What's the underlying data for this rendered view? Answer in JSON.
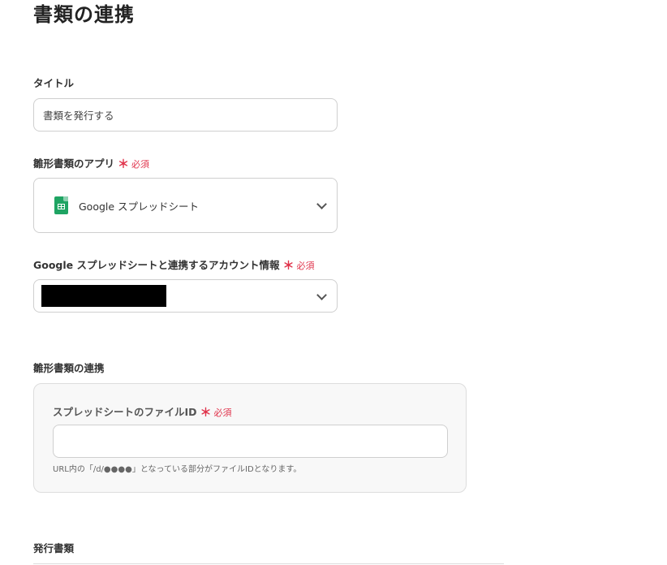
{
  "page_title": "書類の連携",
  "title_field": {
    "label": "タイトル",
    "value": "書類を発行する"
  },
  "template_app": {
    "label": "雛形書類のアプリ",
    "required_mark": "＊",
    "required_text": "必須",
    "selected_value": "Google スプレッドシート",
    "icon": "google-sheets-icon"
  },
  "account": {
    "label": "Google スプレッドシートと連携するアカウント情報",
    "required_mark": "＊",
    "required_text": "必須"
  },
  "template_link": {
    "section_label": "雛形書類の連携",
    "file_id_label": "スプレッドシートのファイルID",
    "required_mark": "＊",
    "required_text": "必須",
    "file_id_value": "",
    "hint": "URL内の「/d/●●●●」となっている部分がファイルIDとなります。"
  },
  "issued_doc": {
    "label": "発行書類"
  },
  "colors": {
    "required": "#e0344c",
    "sheets_green": "#1fa463",
    "border": "#cfcfcf",
    "panel_bg": "#f8f8f8"
  }
}
